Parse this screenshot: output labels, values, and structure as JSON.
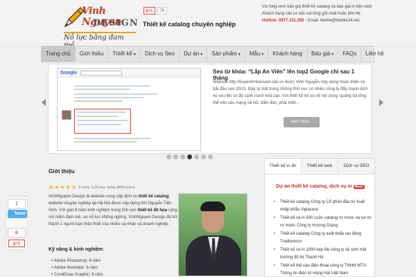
{
  "header": {
    "logo_name": "Vinh Nguyen",
    "logo_design": "DESIGN",
    "logo_slogan": "Nỗ lực bằng đam mê",
    "gplus_label": "g+1",
    "gplus_count": "76",
    "tagline": "Thiết kế catalog chuyên nghiệp",
    "contact_line1": "Vui lòng xem báo giá thiết kế catalog và báo giá in trên web",
    "contact_line2": "Khách hàng cần tư vấn vui lòng gửi mail hoặc liên hệ:",
    "hotline_label": "Hotline: 0977.311.359",
    "email_text": " - Email: lienhe@thietke24.net"
  },
  "nav": {
    "items": [
      {
        "label": "Trang chủ",
        "caret": ""
      },
      {
        "label": "Giới thiệu",
        "caret": ""
      },
      {
        "label": "Thiết kế",
        "caret": "▾"
      },
      {
        "label": "Dịch vụ Seo",
        "caret": ""
      },
      {
        "label": "Dự án",
        "caret": "▾"
      },
      {
        "label": "Sản phẩm",
        "caret": "▾"
      },
      {
        "label": "Mẫu",
        "caret": "▾"
      },
      {
        "label": "Khách hàng",
        "caret": ""
      },
      {
        "label": "Báo giá",
        "caret": "▾"
      },
      {
        "label": "FAQs",
        "caret": ""
      },
      {
        "label": "Liên hệ",
        "caret": ""
      }
    ]
  },
  "slider": {
    "google_logo": "Google",
    "title": "Seo từ khóa: “Lắp An Viên” lên top2 Google chỉ sau 1 tháng",
    "text": "Website http://truyenhinhanvien.net.vn được Vinh Nguyễn Xây dựng hoàn thiện và bắt đầu seo 20/11. Đây là một trong những lĩnh vực có nhiều công ty đẩy mạnh dịch vụ seo lên cỏ độ cạnh tranh khá cao. Với thiết kế tối ưu về nội dung, quảng bá tổng thể trên các mạng xã hội, diễn đàn, phát triển...",
    "more_label": "Xem thêm...",
    "dot_count": 7,
    "active_dot": 3
  },
  "share": {
    "fb_count": "1",
    "tweet_label": "Tweet",
    "gp_count": "8",
    "gp_label": "g+1"
  },
  "intro": {
    "title": "Giới thiệu",
    "rating_text": "3 votes, 5.00 avg. rating (98% score)",
    "text_p1": "VinhNguyen Design là website cung cấp dịch vụ ",
    "text_b1": "thiết kế catalog",
    "text_p2": ", website chuyên nghiệp tại Hà Nội được xây dựng bởi Nguyễn Tiến Vinh. Với gần 8 năm kinh nghiệm trong lĩnh vực ",
    "text_b2": "thiết kế đồ họa",
    "text_p3": " cộng với niềm đam mê, sự nỗ lực không ngừng. VinhNguyen Design đã trở thành 1 người bạn thân thiết của nhiều cá nhân và doanh nghiệp.",
    "skills_title": "Kỹ năng & kinh nghiệm:",
    "skills": [
      "Adobe Photoshop: 8 năm",
      "Adobe Illustrator: 6 năm",
      "CorelDraw Graphic: 8 năm"
    ]
  },
  "sidebar": {
    "tabs": [
      "Thiết kế in ấn",
      "Thiết kế web",
      "Dịch vụ SEO"
    ],
    "heading": "Dự án thiết kế catalog, dịch vụ in",
    "new_badge": "New!",
    "items": [
      "Thiết kế catalog Công ty Cổ phần đầu tư Xuất nhập khẩu Viglacera",
      "Thiết kế và in 500 cuốn catalog rơ moóc và sơ mi rơ moóc Công ty Hương Giang",
      "Thiết kế catalog Công ty xuất khẩu lao động Tradimexco",
      "Thiết kế và in 1000 kẹp file công ty vệ sinh môi trường đô thị Thanh Hà",
      "Thiết kế thẻ cào điện thoại công ty TNHH MTV Thông tin điện tử Hàng Hải Việt Nam"
    ]
  }
}
